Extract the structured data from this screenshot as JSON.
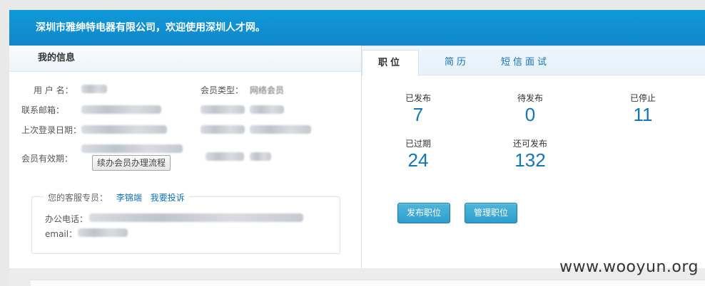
{
  "banner": {
    "text": "深圳市雅绅特电器有限公司，欢迎使用深圳人才网。"
  },
  "my_info": {
    "title": "我的信息",
    "labels": {
      "username": "用 户 名：",
      "email": "联系邮箱：",
      "last_login": "上次登录日期：",
      "membership_valid": "会员有效期：",
      "member_type": "会员类型："
    },
    "values": {
      "member_type": "网络会员"
    },
    "flow_button": "续办会员办理流程",
    "service": {
      "label": "您的客服专员：",
      "name": "李锦端",
      "complaint": "我要投诉",
      "phone_label": "办公电话：",
      "email_label": "email："
    }
  },
  "tabs": [
    {
      "label": "职位",
      "active": true
    },
    {
      "label": "简历",
      "active": false
    },
    {
      "label": "短信面试",
      "active": false
    }
  ],
  "stats": {
    "published": {
      "label": "已发布",
      "value": "7"
    },
    "pending": {
      "label": "待发布",
      "value": "0"
    },
    "stopped": {
      "label": "已停止",
      "value": "11"
    },
    "expired": {
      "label": "已过期",
      "value": "24"
    },
    "available": {
      "label": "还可发布",
      "value": "132"
    }
  },
  "actions": {
    "publish": "发布职位",
    "manage": "管理职位"
  },
  "watermark": "www.wooyun.org",
  "colors": {
    "banner": "#1187c9",
    "accent": "#1376b6",
    "button": "#3aa7d2"
  }
}
